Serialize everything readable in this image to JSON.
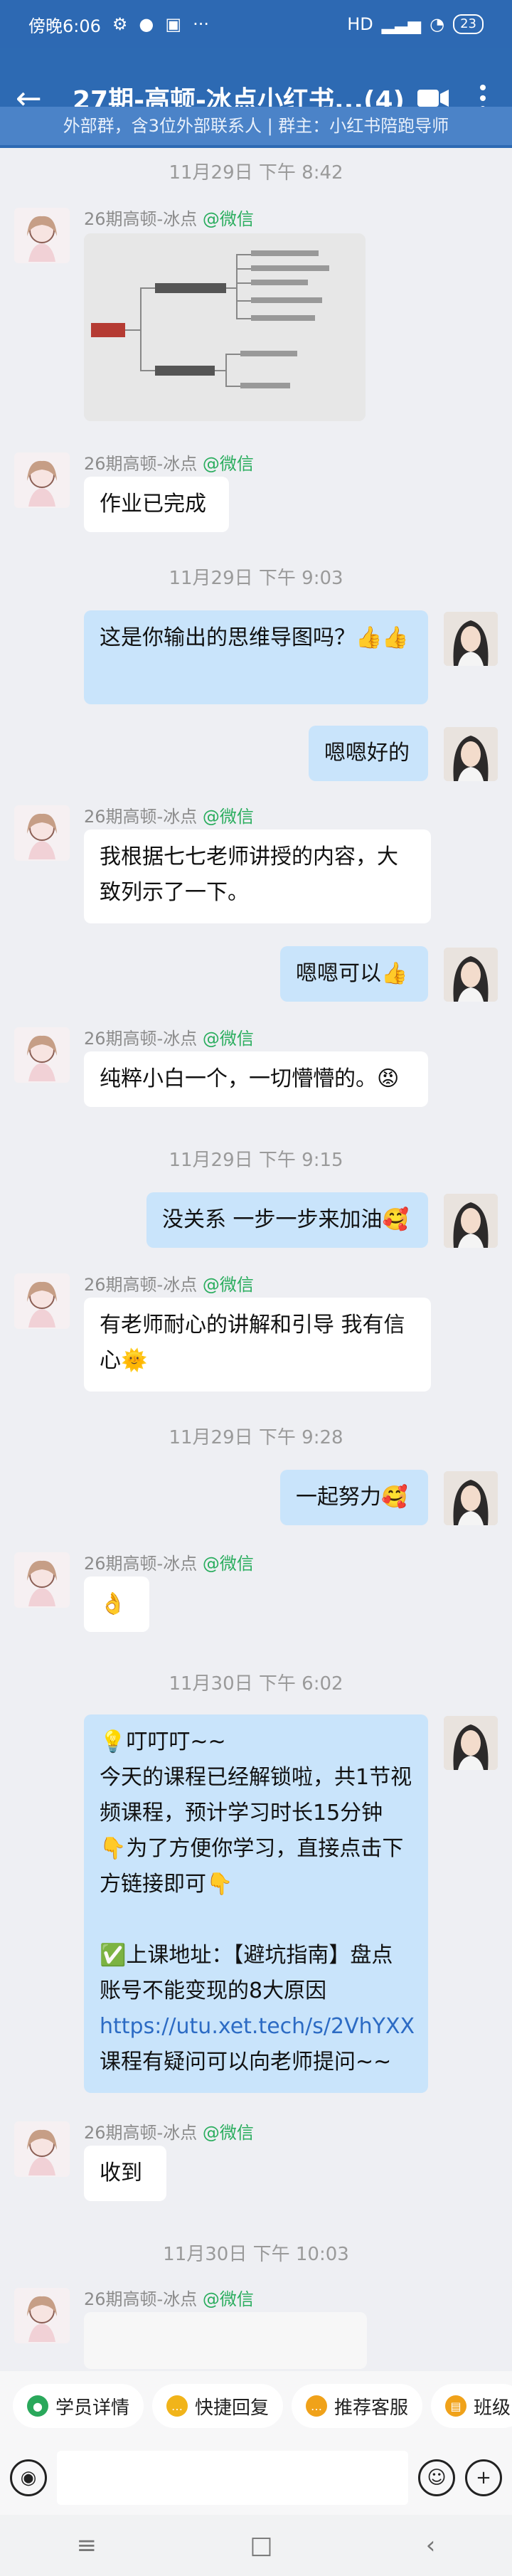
{
  "status": {
    "time": "傍晚6:06",
    "left_icons": [
      "alarm-off-icon",
      "wechat-icon",
      "upload-icon"
    ],
    "more": "···",
    "signal": "HD",
    "battery": "23"
  },
  "header": {
    "title": "27期-高顿-冰点小红书...(4)",
    "subtitle": "外部群，含3位外部联系人 | 群主：小红书陪跑导师"
  },
  "messages": {
    "sender_name": "26期高顿-冰点",
    "sender_tag": "@微信",
    "t1": "11月29日 下午 8:42",
    "m2": "作业已完成",
    "t2": "11月29日 下午 9:03",
    "m3": "这是你输出的思维导图吗？👍👍",
    "m4": "嗯嗯好的",
    "m5": "我根据七七老师讲授的内容，大致列示了一下。",
    "m6": "嗯嗯可以👍",
    "m7": "纯粹小白一个，一切懵懵的。😡",
    "t3": "11月29日 下午 9:15",
    "m8": "没关系 一步一步来加油🥰",
    "m9": "有老师耐心的讲解和引导 我有信心🌞",
    "t4": "11月29日 下午 9:28",
    "m10": "一起努力🥰",
    "m11": "👌",
    "t5": "11月30日 下午 6:02",
    "m12": {
      "line1": "💡叮叮叮~~",
      "line2": "今天的课程已经解锁啦，共1节视频课程，预计学习时长15分钟",
      "line3": "👇为了方便你学习，直接点击下方链接即可👇",
      "line4": "✅上课地址：【避坑指南】盘点账号不能变现的8大原因",
      "link": "https://utu.xet.tech/s/2VhYXX",
      "line5": "课程有疑问可以向老师提问~~"
    },
    "m13": "收到",
    "t6": "11月30日 下午 10:03"
  },
  "quickbar": [
    {
      "label": "学员详情",
      "icon": "person-icon",
      "color": "#2aa85b"
    },
    {
      "label": "快捷回复",
      "icon": "chat-icon",
      "color": "#f1b41a"
    },
    {
      "label": "推荐客服",
      "icon": "chat-icon",
      "color": "#f0a21a"
    },
    {
      "label": "班级",
      "icon": "book-icon",
      "color": "#f0a21a"
    }
  ],
  "nav": [
    "≡",
    "□",
    "‹"
  ]
}
